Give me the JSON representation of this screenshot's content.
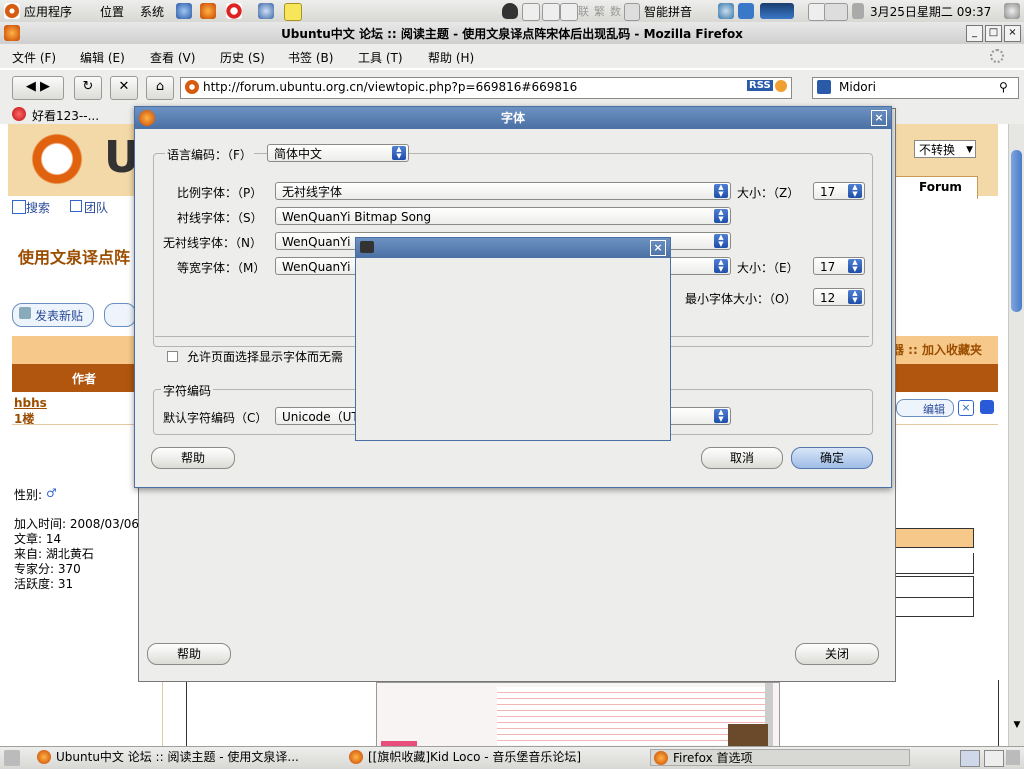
{
  "panel_top": {
    "menu_apps": "应用程序",
    "menu_places": "位置",
    "menu_system": "系统",
    "ime_text": "智能拼音",
    "ime_keys": [
      "联",
      "繁",
      "数"
    ],
    "clock": "3月25日星期二 09:37"
  },
  "firefox": {
    "window_title": "Ubuntu中文 论坛 :: 阅读主题 - 使用文泉译点阵宋体后出现乱码 - Mozilla Firefox",
    "menus": [
      "文件 (F)",
      "编辑 (E)",
      "查看 (V)",
      "历史 (S)",
      "书签 (B)",
      "工具 (T)",
      "帮助 (H)"
    ],
    "url": "http://forum.ubuntu.org.cn/viewtopic.php?p=669816#669816",
    "rss_label": "RSS",
    "search_text": "Midori",
    "bookmark_label": "好看123--..."
  },
  "page": {
    "logo_letter": "U",
    "nav_search": "搜索",
    "nav_group": "团队",
    "topic_title": "使用文泉译点阵",
    "post_new_label": "发表新贴",
    "post_new_accent": "新贴",
    "no_convert": "不转换",
    "forum_tab": "Forum",
    "author_header": "作者",
    "author_name": "hbhs",
    "floor": "1楼",
    "gender_label": "性别:",
    "join_time": "加入时间: 2008/03/06",
    "posts": "文章: 14",
    "from": "来自: 湖北黄石",
    "expert_points": "专家分: 370",
    "activity": "活跃度: 31",
    "bookmark_link": "器 :: 加入收藏夹",
    "edit_label": "编辑"
  },
  "fonts_dialog": {
    "title": "字体",
    "lang_label": "语言编码：（F）",
    "lang_value": "简体中文",
    "proportional_label": "比例字体：（P）",
    "proportional_value": "无衬线字体",
    "serif_label": "衬线字体：（S）",
    "serif_value": "WenQuanYi Bitmap Song",
    "sans_label": "无衬线字体：（N）",
    "sans_value": "WenQuanYi B",
    "mono_label": "等宽字体：（M）",
    "mono_value": "WenQuanYi B",
    "size_label": "大小：（Z）",
    "size_value": "17",
    "mono_size_label": "大小：（E）",
    "mono_size_value": "17",
    "min_size_label": "最小字体大小：（O）",
    "min_size_value": "12",
    "allow_pages_label": "允许页面选择显示字体而无需",
    "charset_group": "字符编码",
    "default_charset_label": "默认字符编码（C）",
    "default_charset_value": "Unicode（UT",
    "help": "帮助",
    "cancel": "取消",
    "ok": "确定"
  },
  "prefs_dialog": {
    "help": "帮助",
    "close": "关闭"
  },
  "taskbar": {
    "items": [
      "Ubuntu中文 论坛 :: 阅读主题 - 使用文泉译...",
      "[[旗帜收藏]Kid Loco - 音乐堡音乐论坛]",
      "Firefox 首选项"
    ]
  },
  "colors": {
    "dialog_title": "#4a6fa3",
    "forum_header": "#b0560e",
    "forum_header_light": "#f6c98a",
    "accent_orange": "#e05a00"
  }
}
